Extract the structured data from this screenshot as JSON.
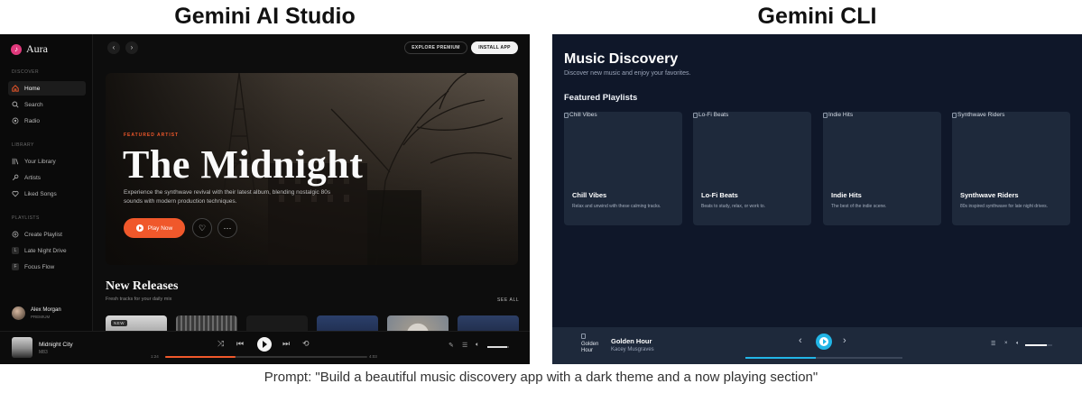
{
  "headings": {
    "left": "Gemini AI Studio",
    "right": "Gemini CLI"
  },
  "prompt": "Prompt: \"Build a beautiful music discovery app with a dark theme and a now playing section\"",
  "aura": {
    "logo": "Aura",
    "sections": {
      "discover": "DISCOVER",
      "library": "LIBRARY",
      "playlists": "PLAYLISTS"
    },
    "nav": {
      "home": "Home",
      "search": "Search",
      "radio": "Radio"
    },
    "library": {
      "your_library": "Your Library",
      "artists": "Artists",
      "liked": "Liked Songs"
    },
    "playlists": {
      "create": "Create Playlist",
      "late_night": "Late Night Drive",
      "focus": "Focus Flow"
    },
    "playlist_letters": {
      "late_night": "L",
      "focus": "F"
    },
    "user": {
      "name": "Alex Morgan",
      "plan": "PREMIUM"
    },
    "topbar": {
      "back": "‹",
      "forward": "›",
      "explore": "EXPLORE PREMIUM",
      "install": "INSTALL APP"
    },
    "hero": {
      "label": "FEATURED ARTIST",
      "title": "The Midnight",
      "desc": "Experience the synthwave revival with their latest album, blending nostalgic 80s sounds with modern production techniques.",
      "play": "Play Now",
      "like": "♡",
      "more": "···"
    },
    "new_releases": {
      "title": "New Releases",
      "sub": "Fresh tracks for your daily mix",
      "see_all": "SEE ALL",
      "badge": "NEW"
    },
    "player": {
      "track": "Midnight City",
      "artist": "M83",
      "elapsed": "1:24",
      "duration": "4:03",
      "progress": 0.35,
      "volume": 0.9
    },
    "colors": {
      "accent": "#f0582b",
      "brand": "#e0397c"
    }
  },
  "cli": {
    "title": "Music Discovery",
    "subtitle": "Discover new music and enjoy your favorites.",
    "featured": "Featured Playlists",
    "cards": [
      {
        "alt": "Chill Vibes",
        "name": "Chill Vibes",
        "desc": "Relax and unwind with these calming tracks."
      },
      {
        "alt": "Lo-Fi Beats",
        "name": "Lo-Fi Beats",
        "desc": "Beats to study, relax, or work to."
      },
      {
        "alt": "Indie Hits",
        "name": "Indie Hits",
        "desc": "The best of the indie scene."
      },
      {
        "alt": "Synthwave Riders",
        "name": "Synthwave Riders",
        "desc": "80s inspired synthwave for late night drives."
      }
    ],
    "player": {
      "cover_alt": "Golden Hour",
      "track": "Golden Hour",
      "artist": "Kacey Musgraves",
      "progress": 0.45,
      "volume": 0.8
    },
    "colors": {
      "accent": "#22b5e6",
      "bg": "#0f1729",
      "card": "#1e293b"
    }
  }
}
